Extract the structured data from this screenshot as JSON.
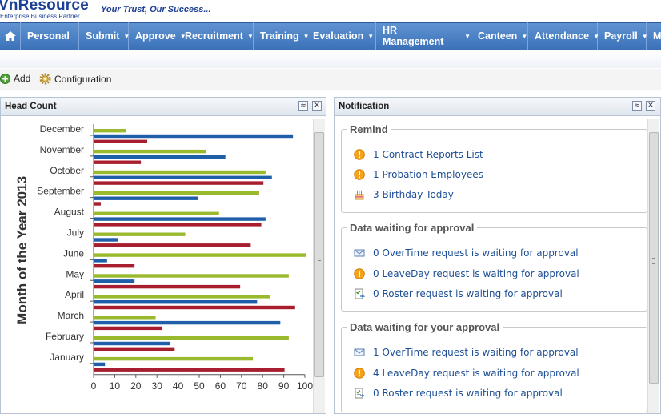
{
  "brand": {
    "logo": "VnResource",
    "subtitle": "Enterprise Business Partner",
    "slogan": "Your Trust, Our Success..."
  },
  "nav": {
    "items": [
      {
        "label": "Personal",
        "dropdown": false
      },
      {
        "label": "Submit",
        "dropdown": true
      },
      {
        "label": "Approve",
        "dropdown": true
      },
      {
        "label": "Recruitment",
        "dropdown": true
      },
      {
        "label": "Training",
        "dropdown": true
      },
      {
        "label": "Evaluation",
        "dropdown": true
      },
      {
        "label": "HR Management",
        "dropdown": true
      },
      {
        "label": "Canteen",
        "dropdown": true
      },
      {
        "label": "Attendance",
        "dropdown": true
      },
      {
        "label": "Payroll",
        "dropdown": true
      },
      {
        "label": "M",
        "dropdown": false
      }
    ]
  },
  "toolbar": {
    "add_label": "Add",
    "config_label": "Configuration"
  },
  "headcount": {
    "title": "Head Count"
  },
  "notification": {
    "title": "Notification",
    "remind": {
      "legend": "Remind",
      "items": [
        {
          "icon": "warning-icon",
          "text": "1 Contract Reports List"
        },
        {
          "icon": "warning-icon",
          "text": "1 Probation Employees"
        },
        {
          "icon": "birthday-cake-icon",
          "text": "3 Birthday Today"
        }
      ]
    },
    "waiting": {
      "legend": "Data waiting for approval",
      "items": [
        {
          "icon": "mail-icon",
          "text": "0 OverTime request is waiting for approval"
        },
        {
          "icon": "warning-icon",
          "text": "0 LeaveDay request is waiting for approval"
        },
        {
          "icon": "roster-icon",
          "text": "0 Roster request is waiting for approval"
        }
      ]
    },
    "your_approval": {
      "legend": "Data waiting for your approval",
      "items": [
        {
          "icon": "mail-icon",
          "text": "1 OverTime request is waiting for approval"
        },
        {
          "icon": "warning-icon",
          "text": "4 LeaveDay request is waiting for approval"
        },
        {
          "icon": "roster-icon",
          "text": "0 Roster request is waiting for approval"
        }
      ]
    }
  },
  "colors": {
    "nav": "#3f76bd",
    "series_green": "#9aba2e",
    "series_blue": "#1f5ea8",
    "series_red": "#a81e2f",
    "link": "#1e4f96"
  },
  "chart_data": {
    "type": "bar",
    "orientation": "horizontal",
    "ylabel": "Month of the Year 2013",
    "xlabel": "",
    "categories": [
      "December",
      "November",
      "October",
      "September",
      "August",
      "July",
      "June",
      "May",
      "April",
      "March",
      "February",
      "January"
    ],
    "xlim": [
      0,
      100
    ],
    "x_ticks": [
      "0",
      "10",
      "20",
      "30",
      "40",
      "50",
      "60",
      "70",
      "80",
      "90",
      "100"
    ],
    "series": [
      {
        "color": "#9aba2e",
        "values": [
          15,
          53,
          81,
          78,
          59,
          43,
          100,
          92,
          83,
          29,
          92,
          75
        ]
      },
      {
        "color": "#1f5ea8",
        "values": [
          94,
          62,
          84,
          49,
          81,
          11,
          6,
          19,
          77,
          88,
          36,
          5
        ]
      },
      {
        "color": "#a81e2f",
        "values": [
          25,
          22,
          80,
          3,
          79,
          74,
          19,
          69,
          95,
          32,
          38,
          90
        ]
      }
    ]
  }
}
